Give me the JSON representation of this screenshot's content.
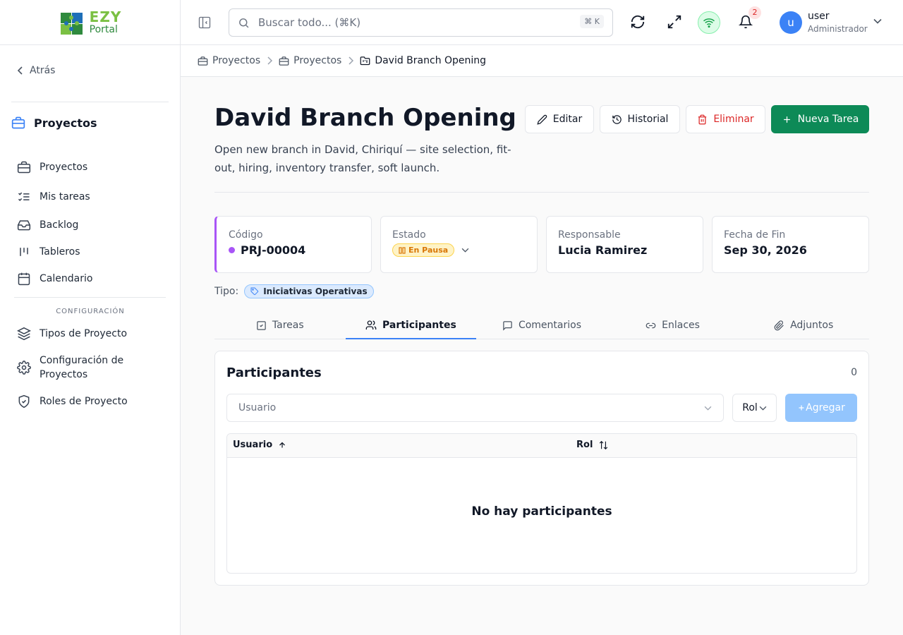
{
  "brand": {
    "name_top": "EZY",
    "name_bottom": "Portal"
  },
  "sidebar": {
    "back_label": "Atrás",
    "section_title": "Proyectos",
    "items": [
      {
        "label": "Proyectos",
        "icon": "briefcase-icon"
      },
      {
        "label": "Mis tareas",
        "icon": "list-checks-icon"
      },
      {
        "label": "Backlog",
        "icon": "inbox-icon"
      },
      {
        "label": "Tableros",
        "icon": "kanban-icon"
      },
      {
        "label": "Calendario",
        "icon": "calendar-icon"
      }
    ],
    "config_heading": "CONFIGURACIÓN",
    "config_items": [
      {
        "label": "Tipos de Proyecto",
        "icon": "layers-icon"
      },
      {
        "label": "Configuración de Proyectos",
        "icon": "gear-icon"
      },
      {
        "label": "Roles de Proyecto",
        "icon": "shield-icon"
      }
    ]
  },
  "topbar": {
    "search_placeholder": "Buscar todo... (⌘K)",
    "search_shortcut": "⌘ K",
    "notifications_count": "2",
    "user": {
      "initial": "u",
      "name": "user",
      "role": "Administrador"
    }
  },
  "breadcrumb": [
    "Proyectos",
    "Proyectos",
    "David Branch Opening"
  ],
  "project": {
    "title": "David Branch Opening",
    "description": "Open new branch in David, Chiriquí — site selection, fit-out, hiring, inventory transfer, soft launch."
  },
  "actions": {
    "edit": "Editar",
    "history": "Historial",
    "delete": "Eliminar",
    "new_task": "Nueva Tarea"
  },
  "cards": {
    "code": {
      "label": "Código",
      "value": "PRJ-00004"
    },
    "status": {
      "label": "Estado",
      "value": "En Pausa"
    },
    "owner": {
      "label": "Responsable",
      "value": "Lucia Ramirez"
    },
    "end_date": {
      "label": "Fecha de Fin",
      "value": "Sep 30, 2026"
    }
  },
  "type": {
    "label": "Tipo:",
    "value": "Iniciativas Operativas"
  },
  "tabs": [
    "Tareas",
    "Participantes",
    "Comentarios",
    "Enlaces",
    "Adjuntos"
  ],
  "active_tab": "Participantes",
  "participants": {
    "title": "Participantes",
    "count": "0",
    "user_placeholder": "Usuario",
    "role_placeholder": "Rol",
    "add_label": "Agregar",
    "columns": [
      "Usuario",
      "Rol"
    ],
    "empty_message": "No hay participantes"
  },
  "colors": {
    "primary": "#0d8a57",
    "accent": "#a855f7",
    "danger": "#dc2626",
    "link": "#3b82f6",
    "status_paused": "#d97706"
  }
}
